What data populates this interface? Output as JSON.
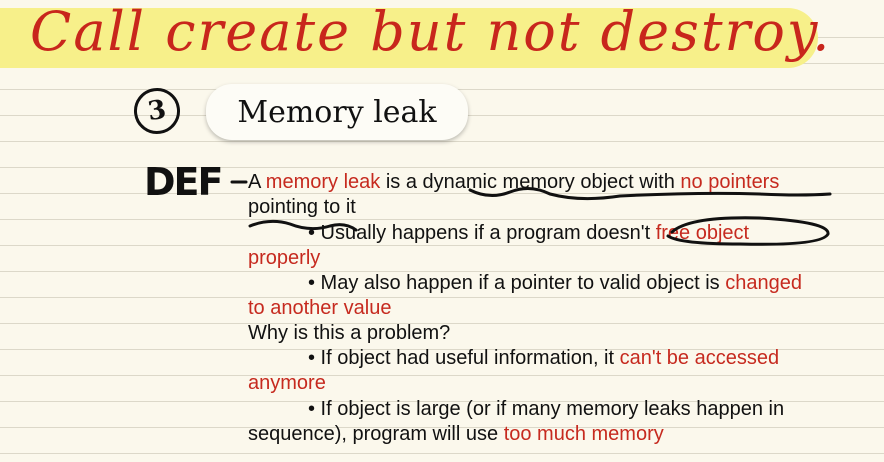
{
  "annotation": {
    "handwritten_title": "Call create but not destroy.",
    "section_number": "3",
    "def_label": "DEF"
  },
  "heading": {
    "title": "Memory leak"
  },
  "content": {
    "l1_a": "A ",
    "l1_b": "memory leak",
    "l1_c": " is a dynamic memory object with ",
    "l1_d": "no pointers",
    "l2": "pointing to it",
    "l3_a": "• Usually happens if a program doesn't ",
    "l3_b": "free object",
    "l4": "properly",
    "l5_a": "• May also happen if a pointer to valid object is ",
    "l5_b": "changed",
    "l6": "to another value",
    "l7": "Why is this a problem?",
    "l8_a": "• If object had useful information, it ",
    "l8_b": "can't be accessed",
    "l9": "anymore",
    "l10": "• If object is large (or if many memory leaks happen in",
    "l11_a": "sequence), program will use ",
    "l11_b": "too much memory"
  },
  "colors": {
    "highlight": "#f7f08a",
    "accent_red": "#c62a1f",
    "ink": "#111111",
    "paper": "#fbf8ec"
  }
}
